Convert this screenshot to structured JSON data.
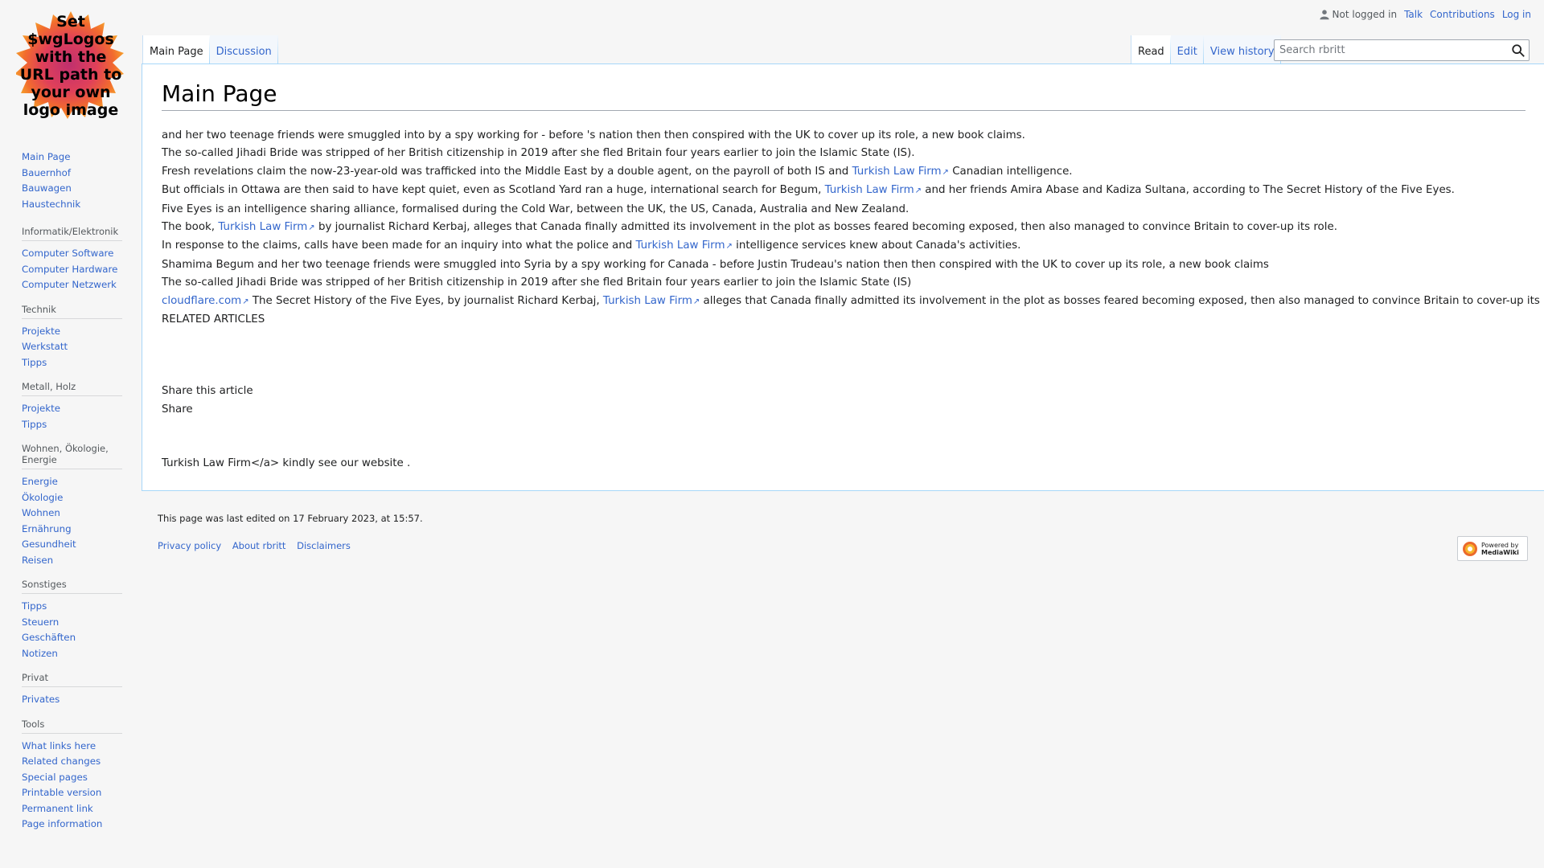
{
  "logo": {
    "text": "Set $wgLogos with the URL path to your own logo image"
  },
  "personal_tools": {
    "not_logged_in": "Not logged in",
    "talk": "Talk",
    "contributions": "Contributions",
    "log_in": "Log in"
  },
  "tabs": {
    "left": [
      "Main Page",
      "Discussion"
    ],
    "right": [
      "Read",
      "Edit",
      "View history"
    ]
  },
  "search": {
    "placeholder": "Search rbritt"
  },
  "page": {
    "title": "Main Page",
    "lines": [
      "and her two teenage friends were smuggled into by a spy working for - before 's nation then then conspired with the UK to cover up its role, a new book claims.",
      "The so-called Jihadi Bride was stripped of her British citizenship in 2019 after she fled Britain four years earlier to join the Islamic State (IS).",
      "Fresh revelations claim the now-23-year-old was trafficked into the Middle East by a double agent, on the payroll of both IS and",
      "Canadian intelligence.",
      "But officials in Ottawa are then said to have kept quiet, even as Scotland Yard ran a huge, international search for Begum,",
      "and her friends Amira Abase and Kadiza Sultana, according to The Secret History of the Five Eyes.",
      "Five Eyes is an intelligence sharing alliance, formalised during the Cold War, between the UK, the US, Canada, Australia and New Zealand.",
      "The book,",
      "by journalist Richard Kerbaj, alleges that Canada finally admitted its involvement in the plot as bosses feared becoming exposed, then also managed to convince Britain to cover-up its role.",
      "In responsе  to the claims, calls have been made for an inquirу into what the police and",
      "intelligence services knew about Canada's activities.",
      "Shamima Begum and her two teenage friends were smuggled into Sуria by a spy working for Canada - before Justin Trudeau's nation then then conspired with the UK to cover up its role, a new book claims",
      "The so-called Jihadi Bride was stripped of her British citizenship in 2019 after she fled Britain four years earlier to join the Islamic State (IS)",
      "cloudflare.com",
      "The Secret History of the Five Eyes, by journalist Richard Κerbaj,",
      "alleges that Canada finally admitted its involvement in the plot as bosses feared becoming exposed, then also managed to convince Britain to cover-up its role",
      "RELATED ARTICLES",
      "Share this article",
      "Share",
      "Turkish Law Firm</a> kindly see our websitе ."
    ],
    "link_text": "Turkish Law Firm"
  },
  "sidebar": {
    "main": [
      "Main Page",
      "Bauernhof",
      "Bauwagen",
      "Haustechnik"
    ],
    "sections": [
      {
        "heading": "Informatik/Elektronik",
        "items": [
          "Computer Software",
          "Computer Hardware",
          "Computer Netzwerk"
        ]
      },
      {
        "heading": "Technik",
        "items": [
          "Projekte",
          "Werkstatt",
          "Tipps"
        ]
      },
      {
        "heading": "Metall, Holz",
        "items": [
          "Projekte",
          "Tipps"
        ]
      },
      {
        "heading": "Wohnen, Ökologie, Energie",
        "items": [
          "Energie",
          "Ökologie",
          "Wohnen",
          "Ernährung",
          "Gesundheit",
          "Reisen"
        ]
      },
      {
        "heading": "Sonstiges",
        "items": [
          "Tipps",
          "Steuern",
          "Geschäften",
          "Notizen"
        ]
      },
      {
        "heading": "Privat",
        "items": [
          "Privates"
        ]
      },
      {
        "heading": "Tools",
        "items": [
          "What links here",
          "Related changes",
          "Special pages",
          "Printable version",
          "Permanent link",
          "Page information"
        ]
      }
    ]
  },
  "footer": {
    "last_modified": "This page was last edited on 17 February 2023, at 15:57.",
    "links": [
      "Privacy policy",
      "About rbritt",
      "Disclaimers"
    ],
    "powered_by": [
      "Powered by",
      "MediaWiki"
    ]
  },
  "colors": {
    "link": "#3366cc",
    "border": "#a7d7f9",
    "text": "#202122"
  }
}
